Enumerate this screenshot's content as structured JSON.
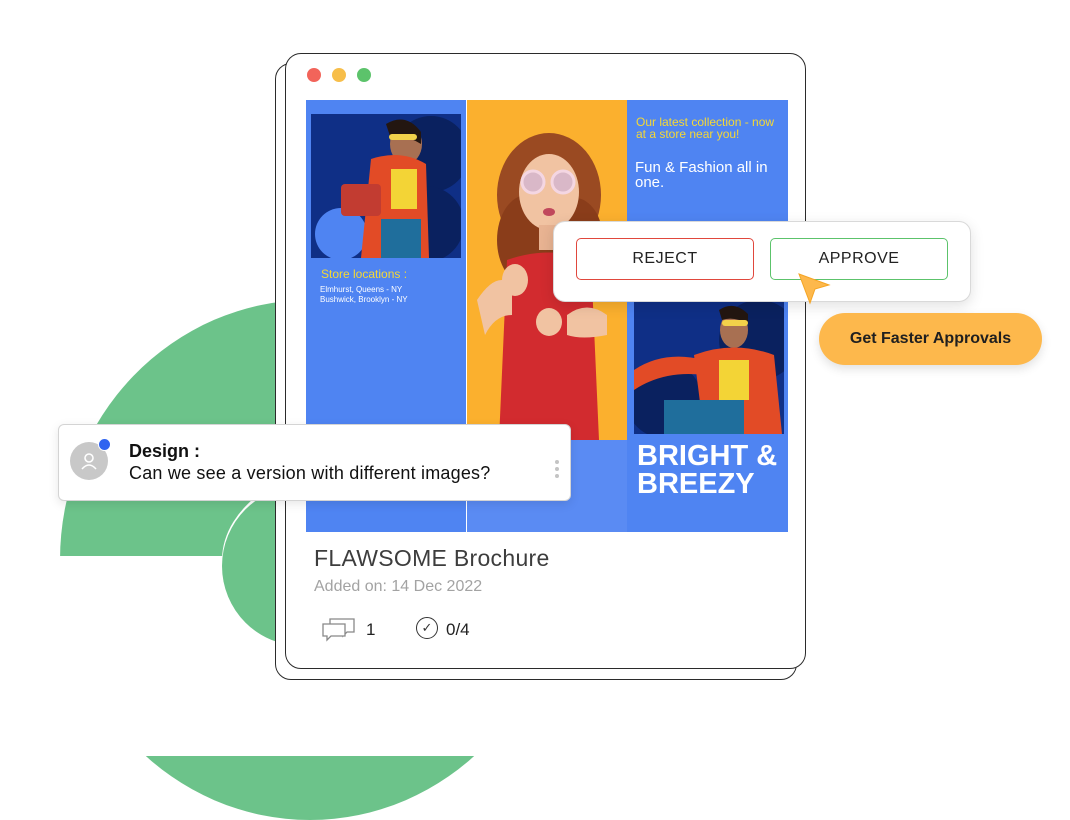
{
  "window": {
    "controls": [
      "close",
      "minimize",
      "maximize"
    ]
  },
  "brochure": {
    "store_title": "Store locations :",
    "store_lines": [
      "Elmhurst, Queens - NY",
      "Bushwick, Brooklyn - NY"
    ],
    "promo_line_1": "Our latest collection - now at a store near you!",
    "promo_line_2": "Fun & Fashion all in one.",
    "headline": "BRIGHT & BREEZY"
  },
  "card": {
    "title": "FLAWSOME Brochure",
    "date": "Added on: 14 Dec 2022",
    "comments_count": "1",
    "tasks_count": "0/4",
    "icons": {
      "comments": "chat-bubbles-icon",
      "tasks": "check-circle-icon"
    }
  },
  "approval": {
    "reject_label": "REJECT",
    "approve_label": "APPROVE",
    "callout": "Get Faster Approvals"
  },
  "comment": {
    "author": "Design :",
    "text": "Can we see a version with different images?"
  },
  "colors": {
    "brand_blue": "#4f84f2",
    "accent_orange": "#fdb84c",
    "reject_red": "#e0473d",
    "approve_green": "#5cc36b",
    "decor_green": "#6cc38a"
  }
}
